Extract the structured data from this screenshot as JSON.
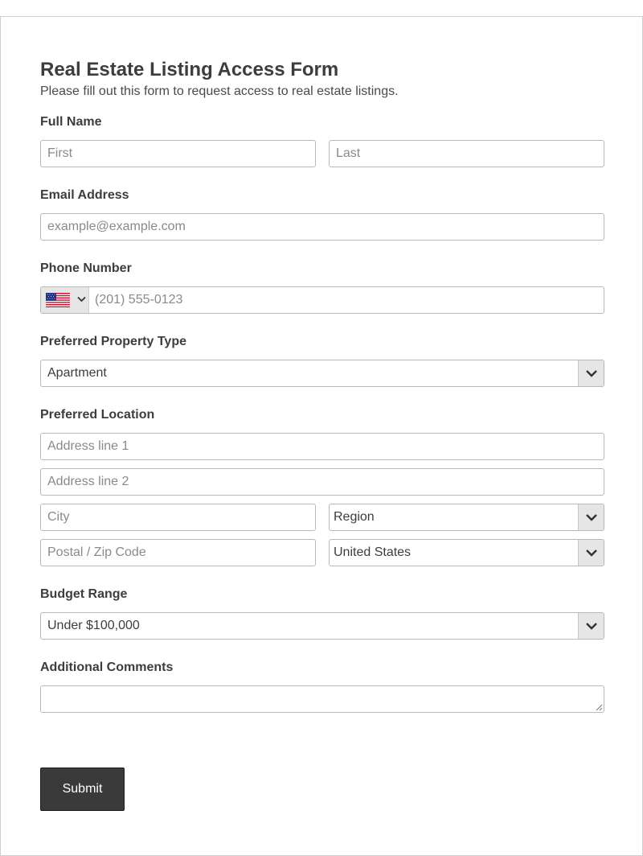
{
  "form": {
    "title": "Real Estate Listing Access Form",
    "subtitle": "Please fill out this form to request access to real estate listings."
  },
  "full_name": {
    "label": "Full Name",
    "first_placeholder": "First",
    "last_placeholder": "Last",
    "first_value": "",
    "last_value": ""
  },
  "email": {
    "label": "Email Address",
    "placeholder": "example@example.com",
    "value": ""
  },
  "phone": {
    "label": "Phone Number",
    "country_flag_icon": "us-flag-icon",
    "placeholder": "(201) 555-0123",
    "value": ""
  },
  "property_type": {
    "label": "Preferred Property Type",
    "selected": "Apartment"
  },
  "location": {
    "label": "Preferred Location",
    "address1_placeholder": "Address line 1",
    "address2_placeholder": "Address line 2",
    "city_placeholder": "City",
    "region_selected": "Region",
    "postal_placeholder": "Postal / Zip Code",
    "country_selected": "United States"
  },
  "budget": {
    "label": "Budget Range",
    "selected": "Under $100,000"
  },
  "comments": {
    "label": "Additional Comments",
    "value": ""
  },
  "submit": {
    "label": "Submit"
  },
  "colors": {
    "submit_bg": "#3a3a3a",
    "select_button_bg": "#e6e6e6",
    "border": "#b8b8b8"
  }
}
